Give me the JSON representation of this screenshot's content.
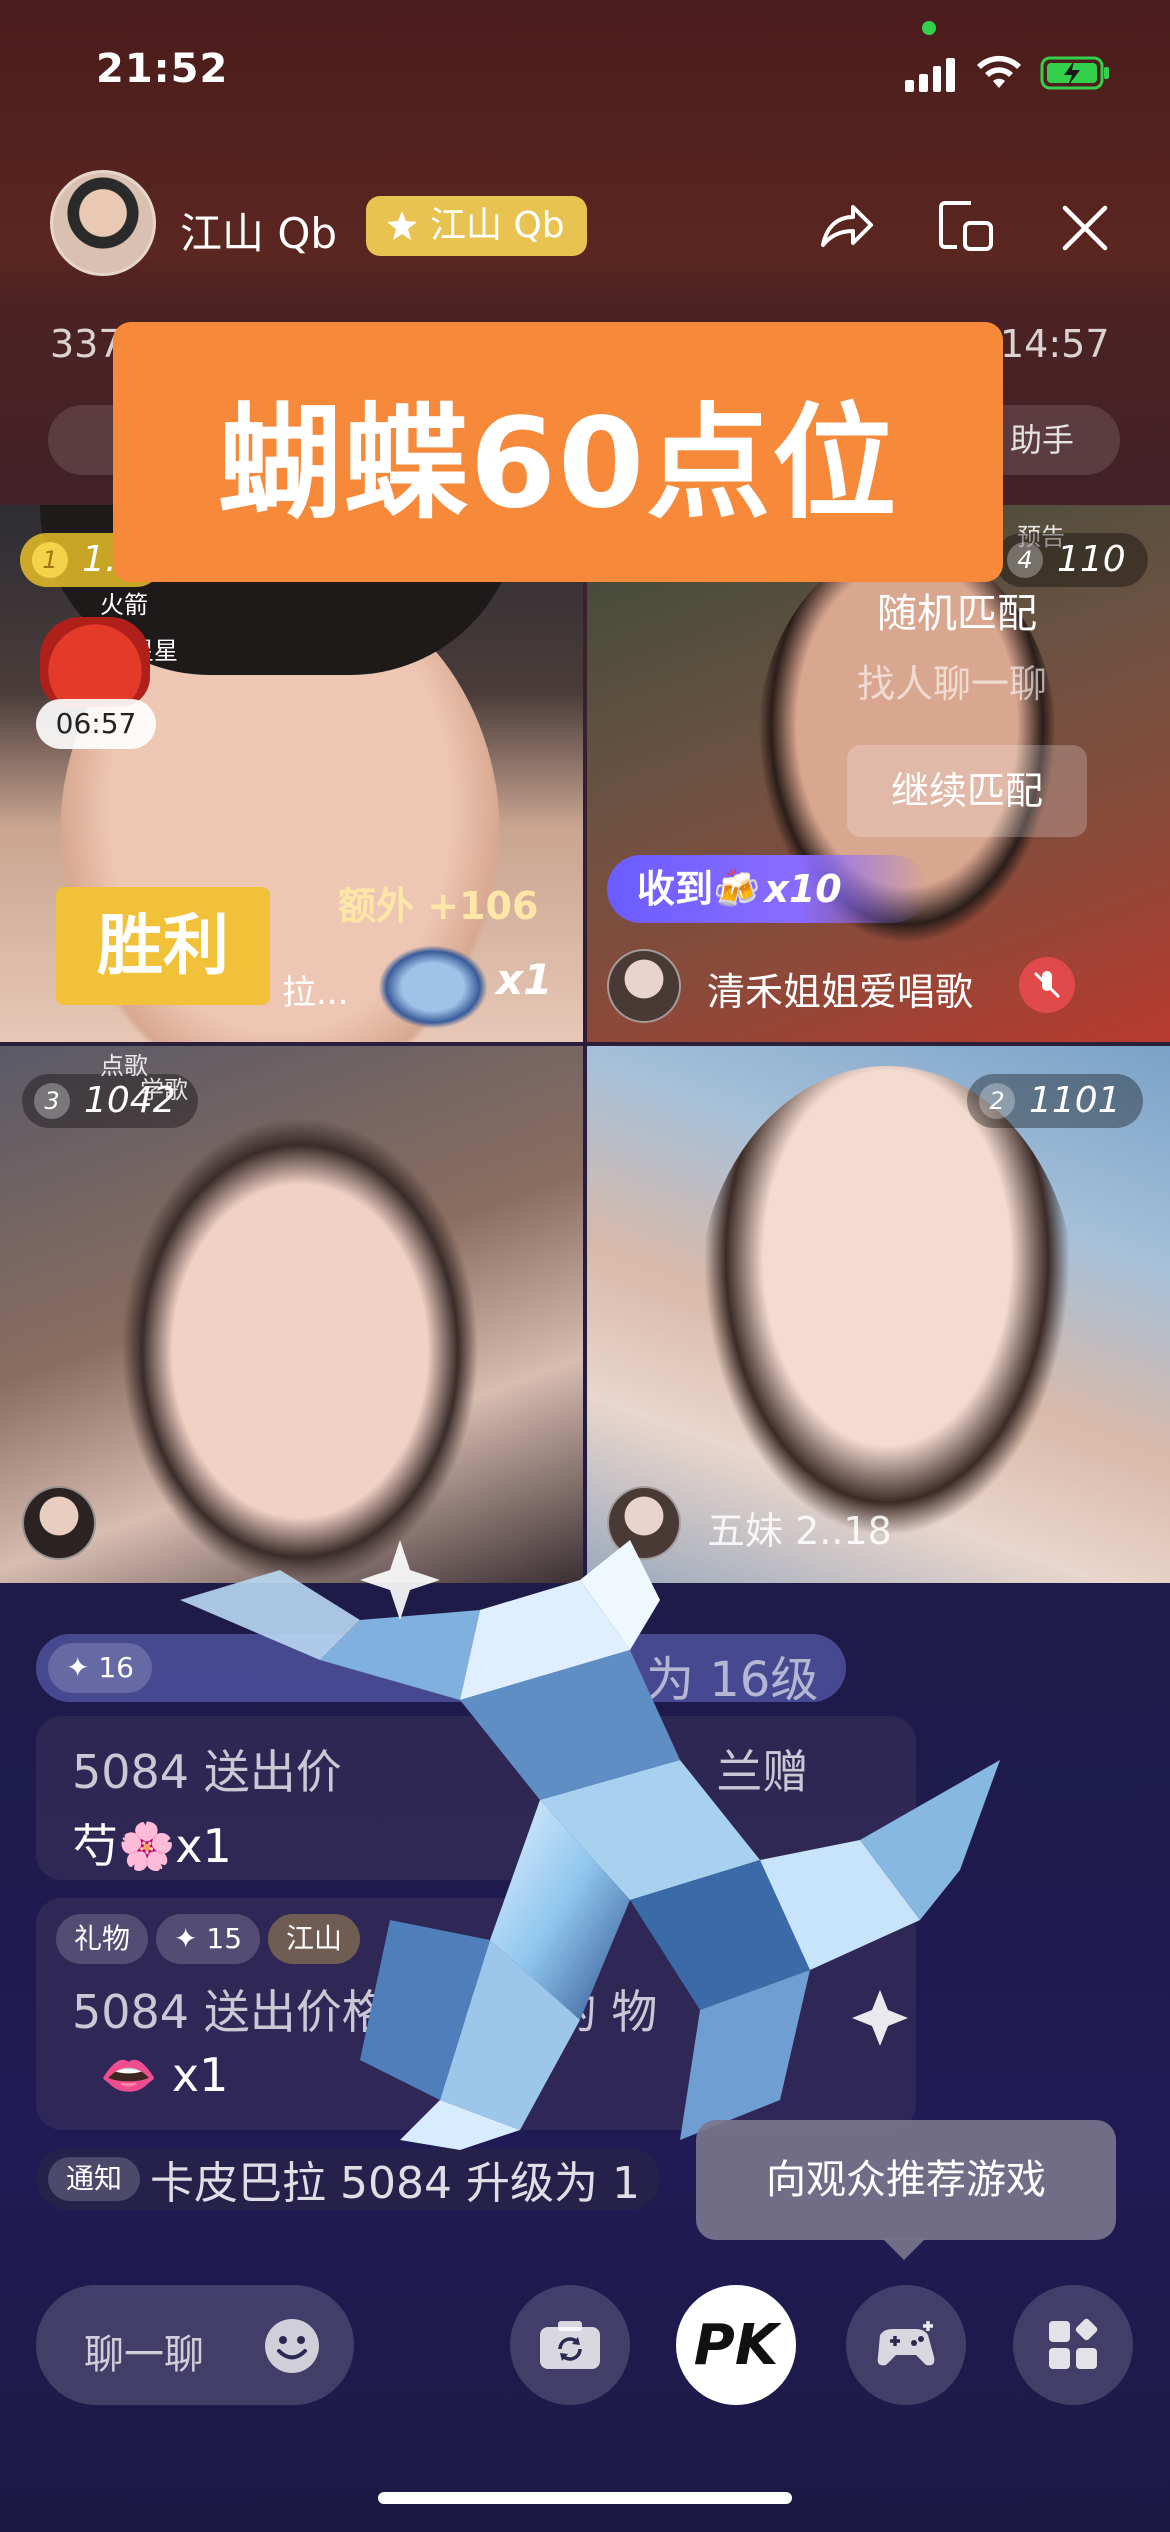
{
  "status_bar": {
    "time": "21:52"
  },
  "header": {
    "host_name": "江山 Qb",
    "host_badge": "江山 Qb",
    "viewer_count": "337",
    "timer": "14:57",
    "right_pill": "助手"
  },
  "banner": {
    "text": "蝴蝶60点位"
  },
  "tiles": [
    {
      "rank": "1",
      "score": "1…",
      "small_line1": "火箭",
      "small_line2": "星星",
      "timer": "06:57",
      "extra": "额外 +106",
      "victory": "胜利",
      "name_partial": "拉...",
      "gift_count": "x1"
    },
    {
      "rank": "4",
      "score": "110",
      "top_right_label": "预告",
      "random_match": "随机匹配",
      "find_chat": "找人聊一聊",
      "continue": "继续匹配",
      "received_label": "收到🍻",
      "received_count": "x10",
      "guest_name": "清禾姐姐爱唱歌"
    },
    {
      "rank": "3",
      "score": "1042",
      "small_line1": "点歌",
      "small_line2": "学歌"
    },
    {
      "rank": "2",
      "score": "1101",
      "guest_name": "五妹 2..18"
    }
  ],
  "chat": {
    "level_chip": "✦ 16",
    "level_text": "为 16级",
    "msg1_line1": "5084 送出价",
    "msg1_line1_tail": "兰赠",
    "msg1_line2": "芍🌸x1",
    "msg2_tag": "礼物",
    "msg2_level": "✦ 15",
    "msg2_user": "江山",
    "msg2_line1": "5084 送出价格 166 豆的 物",
    "msg2_line2": "👄 x1",
    "notice_tag": "通知",
    "notice_text": "卡皮巴拉 5084 升级为 1"
  },
  "tooltip": {
    "text": "向观众推荐游戏"
  },
  "bottom_bar": {
    "chat_placeholder": "聊一聊",
    "pk_label": "PK"
  },
  "colors": {
    "banner": "#f6893a",
    "badge": "#e8c351",
    "victory": "#f2c13a",
    "received_gradient": "#6b5cff"
  }
}
